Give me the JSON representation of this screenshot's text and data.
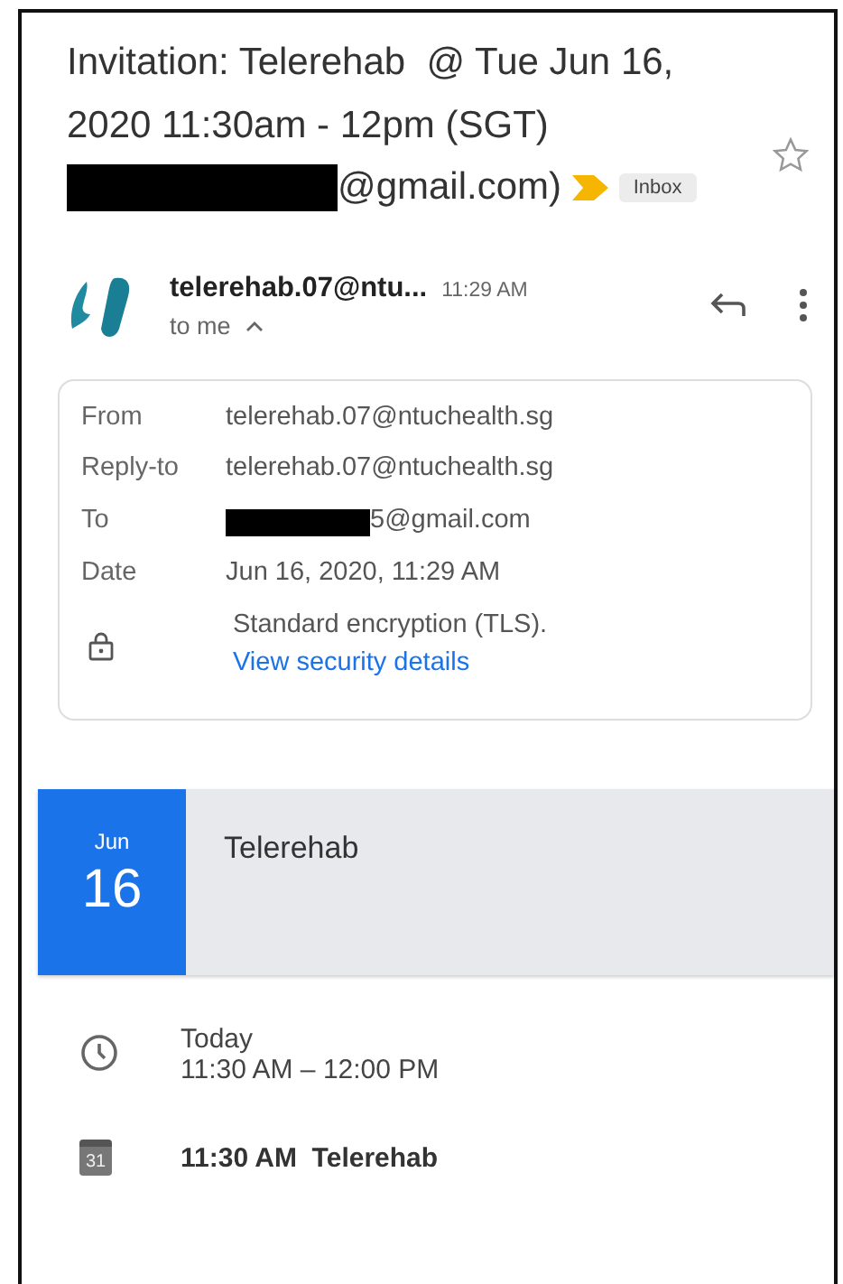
{
  "subject": {
    "before_redaction": "Invitation: Telerehab  @ Tue Jun 16, 2020 11:30am - 12pm (SGT)",
    "after_redaction": "@gmail.com)",
    "starred": false
  },
  "label": {
    "text": "Inbox",
    "important": true
  },
  "message": {
    "sender": "telerehab.07@ntu...",
    "time": "11:29 AM",
    "recipient_line": "to me",
    "expanded": true
  },
  "details": [
    {
      "kind": "field",
      "label": "From",
      "value": "telerehab.07@ntuchealth.sg",
      "redacted": false
    },
    {
      "kind": "field",
      "label": "Reply-to",
      "value": "telerehab.07@ntuchealth.sg",
      "redacted": false
    },
    {
      "kind": "field",
      "label": "To",
      "value": "5@gmail.com",
      "redacted": true
    },
    {
      "kind": "field",
      "label": "Date",
      "value": "Jun 16, 2020, 11:29 AM",
      "redacted": false
    },
    {
      "kind": "security",
      "value": "Standard encryption (TLS).",
      "link": "View security details"
    }
  ],
  "event": {
    "month": "Jun",
    "day": "16",
    "title": "Telerehab"
  },
  "event_rows": [
    {
      "kind": "time",
      "lines": [
        "Today",
        "11:30 AM – 12:00 PM"
      ]
    },
    {
      "kind": "calendar",
      "icon_text": "31",
      "lines": [
        "11:30 AM  Telerehab"
      ]
    }
  ]
}
